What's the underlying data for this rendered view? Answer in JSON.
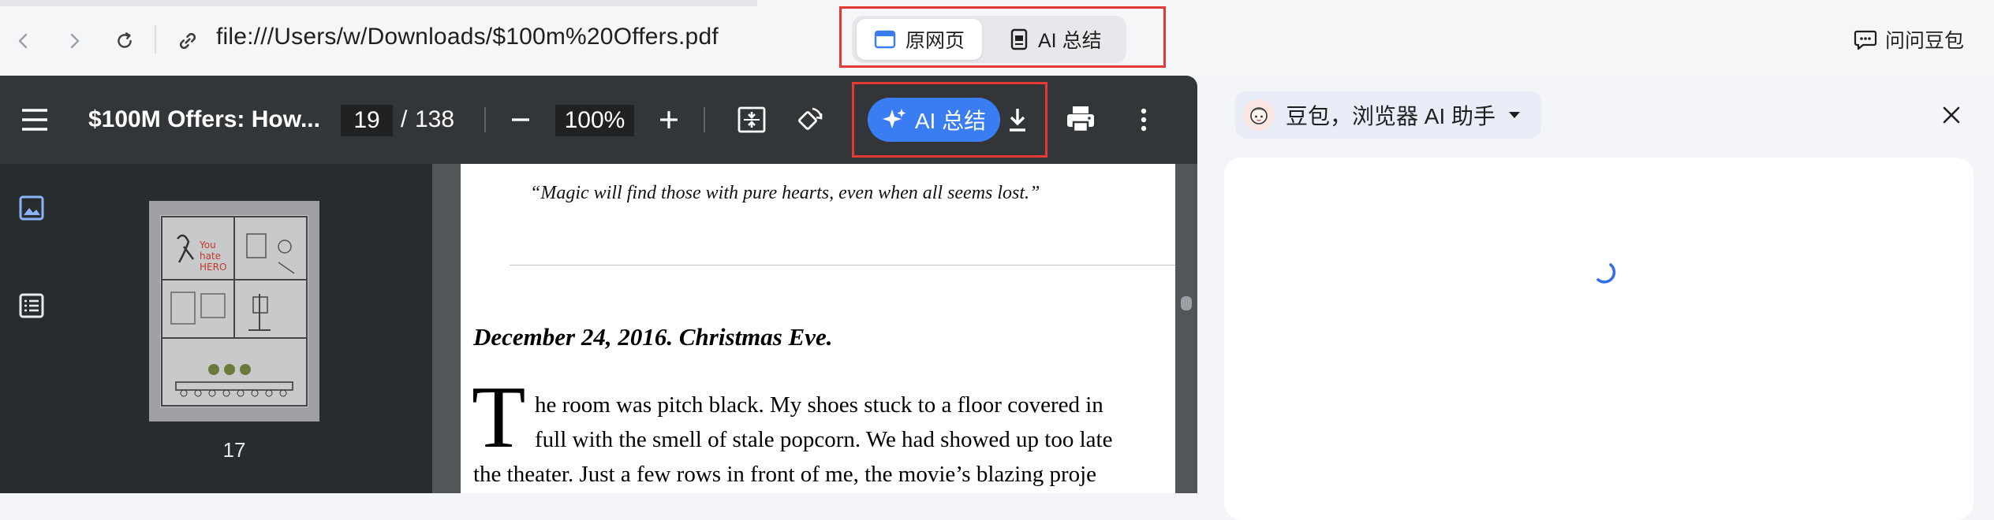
{
  "browser": {
    "url": "file:///Users/w/Downloads/$100m%20Offers.pdf",
    "view_toggle": {
      "original_label": "原网页",
      "summary_label": "AI 总结"
    },
    "ask_label": "问问豆包"
  },
  "pdf": {
    "title": "$100M Offers: How...",
    "current_page": "19",
    "page_separator": "/",
    "total_pages": "138",
    "zoom": "100%",
    "ai_summary_label": "AI 总结",
    "thumbnail_page_label": "17",
    "content": {
      "quote": "“Magic will find those with pure hearts, even when all seems lost.”",
      "heading": "December 24, 2016. Christmas Eve.",
      "drop_cap": "T",
      "line1": "he room was pitch black. My shoes stuck to a floor covered in",
      "line2": "full with the smell of stale popcorn. We had showed up too late",
      "line3": "the theater. Just a few rows in front of me, the movie’s blazing proje"
    }
  },
  "assistant": {
    "title": "豆包，浏览器 AI 助手"
  },
  "colors": {
    "accent_blue": "#3a7cf2",
    "highlight_red": "#e53935",
    "toolbar_dark": "#323639"
  }
}
